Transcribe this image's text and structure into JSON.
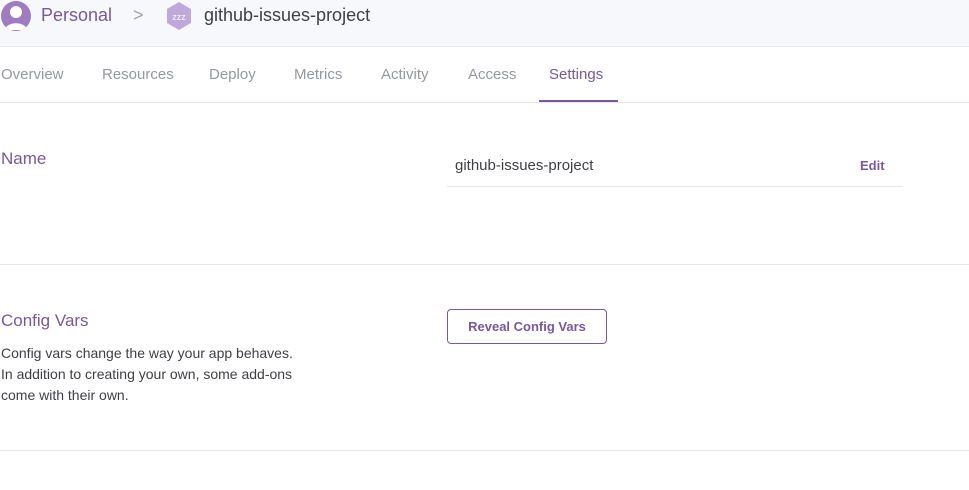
{
  "breadcrumb": {
    "account": "Personal",
    "separator": ">",
    "app_name": "github-issues-project",
    "app_icon_text": "zzz"
  },
  "tabs": [
    {
      "label": "Overview",
      "active": false
    },
    {
      "label": "Resources",
      "active": false
    },
    {
      "label": "Deploy",
      "active": false
    },
    {
      "label": "Metrics",
      "active": false
    },
    {
      "label": "Activity",
      "active": false
    },
    {
      "label": "Access",
      "active": false
    },
    {
      "label": "Settings",
      "active": true
    }
  ],
  "name_section": {
    "title": "Name",
    "value": "github-issues-project",
    "edit_label": "Edit"
  },
  "config_vars": {
    "title": "Config Vars",
    "description": "Config vars change the way your app behaves. In addition to creating your own, some add-ons come with their own.",
    "reveal_button": "Reveal Config Vars"
  },
  "colors": {
    "accent": "#79589f",
    "muted_text": "#96989f",
    "body_text": "#3f3f44",
    "border": "#e3e6ec"
  },
  "icons": {
    "avatar": "user-avatar-icon",
    "app": "sleeping-app-hexagon-icon"
  }
}
